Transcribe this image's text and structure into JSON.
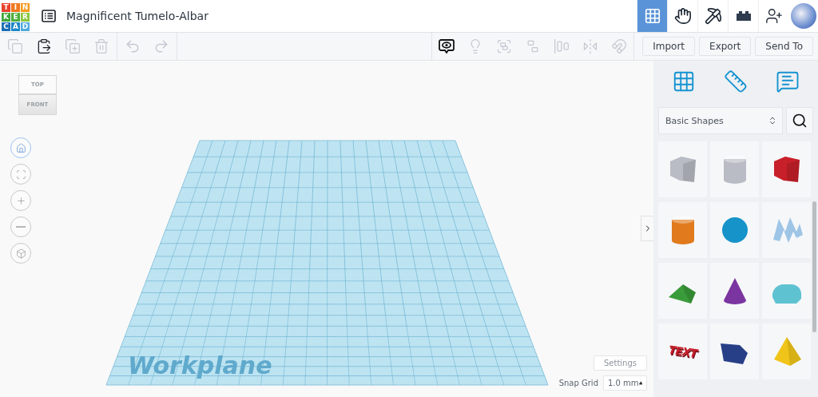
{
  "header": {
    "logo": [
      {
        "letter": "T",
        "color": "#e8412c"
      },
      {
        "letter": "I",
        "color": "#f0791e"
      },
      {
        "letter": "N",
        "color": "#f39a1d"
      },
      {
        "letter": "K",
        "color": "#3fa63b"
      },
      {
        "letter": "E",
        "color": "#4cae3c"
      },
      {
        "letter": "R",
        "color": "#8cc63f"
      },
      {
        "letter": "C",
        "color": "#1b6fb7"
      },
      {
        "letter": "A",
        "color": "#1e88c7"
      },
      {
        "letter": "D",
        "color": "#4fa9dd"
      }
    ],
    "title": "Magnificent Tumelo-Albar",
    "views": [
      {
        "kind": "grid",
        "selected": true
      },
      {
        "kind": "hand",
        "selected": false
      },
      {
        "kind": "pickaxe",
        "selected": false
      },
      {
        "kind": "brick",
        "selected": false
      }
    ]
  },
  "toolbar": {
    "edit_tools": [
      {
        "kind": "copy",
        "disabled": true
      },
      {
        "kind": "paste",
        "disabled": false
      },
      {
        "kind": "duplicate",
        "disabled": true
      },
      {
        "kind": "delete",
        "disabled": true
      }
    ],
    "history_tools": [
      {
        "kind": "undo",
        "disabled": true
      },
      {
        "kind": "redo",
        "disabled": true
      }
    ],
    "shape_tools": [
      {
        "kind": "note",
        "disabled": false
      },
      {
        "kind": "light",
        "disabled": true
      },
      {
        "kind": "group",
        "disabled": true
      },
      {
        "kind": "ungroup",
        "disabled": true
      },
      {
        "kind": "align",
        "disabled": true
      },
      {
        "kind": "mirror",
        "disabled": true
      },
      {
        "kind": "magnet",
        "disabled": true
      }
    ],
    "buttons": [
      "Import",
      "Export",
      "Send To"
    ]
  },
  "view_cube": {
    "top": "TOP",
    "front": "FRONT"
  },
  "nav_controls": [
    {
      "kind": "home",
      "selected": true
    },
    {
      "kind": "fit",
      "selected": false
    },
    {
      "kind": "zoom-in",
      "selected": false
    },
    {
      "kind": "zoom-out",
      "selected": false
    },
    {
      "kind": "ortho",
      "selected": false
    }
  ],
  "workplane": {
    "label": "Workplane"
  },
  "settings_button": "Settings",
  "snap_grid": {
    "label": "Snap Grid",
    "value": "1.0 mm"
  },
  "panel": {
    "tabs": [
      {
        "kind": "grid"
      },
      {
        "kind": "ruler"
      },
      {
        "kind": "note"
      }
    ],
    "category": "Basic Shapes",
    "shapes": [
      {
        "kind": "box",
        "color": "#b9bcc4"
      },
      {
        "kind": "cylinder",
        "color": "#b9bcc4"
      },
      {
        "kind": "box",
        "color": "#c8202a"
      },
      {
        "kind": "cylinder",
        "color": "#e07a1c"
      },
      {
        "kind": "sphere",
        "color": "#1693c9"
      },
      {
        "kind": "scribble",
        "color": "#9ec5e6"
      },
      {
        "kind": "roof",
        "color": "#3a9b3a"
      },
      {
        "kind": "cone",
        "color": "#7b35a0"
      },
      {
        "kind": "round-roof",
        "color": "#5fc2d0"
      },
      {
        "kind": "text",
        "color": "#c61e2a",
        "label": "TEXT"
      },
      {
        "kind": "polygon",
        "color": "#273f86"
      },
      {
        "kind": "pyramid",
        "color": "#f0c419"
      }
    ]
  }
}
